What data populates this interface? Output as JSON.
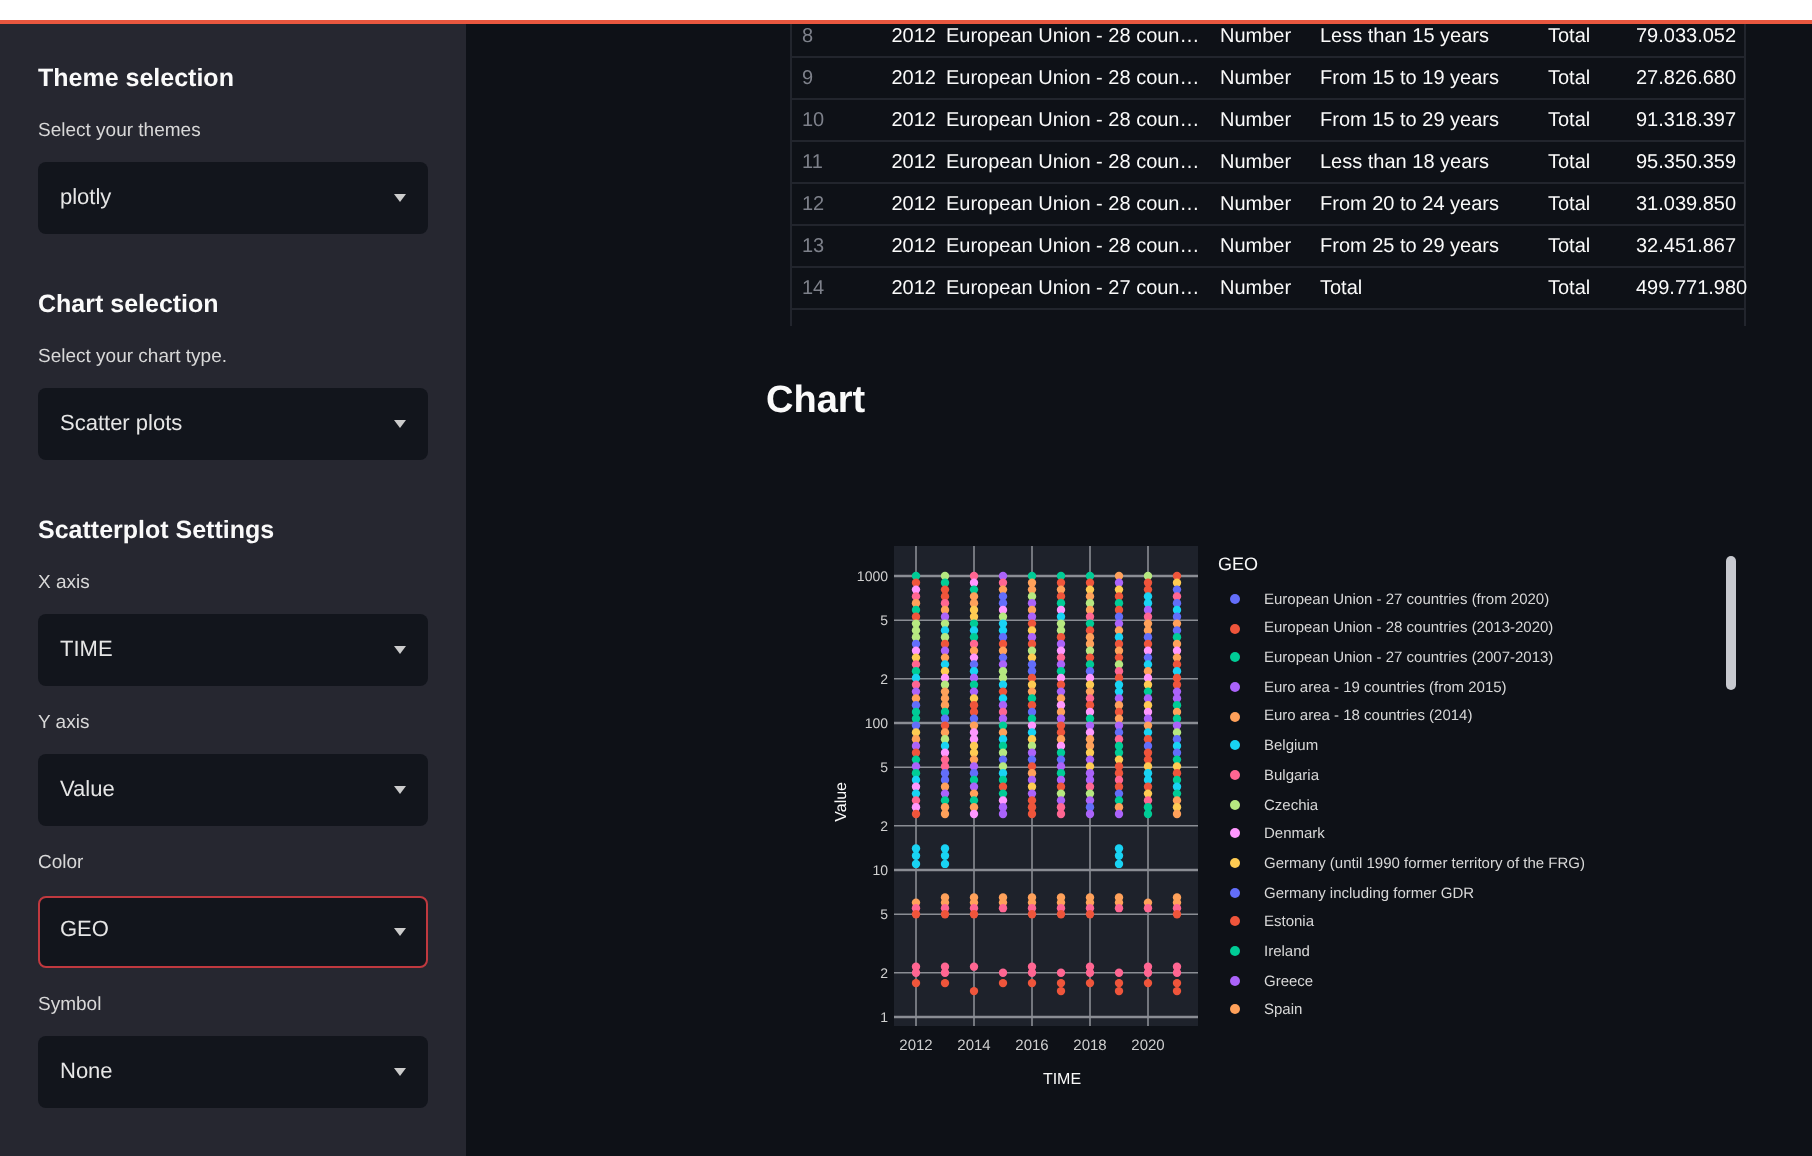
{
  "sidebar": {
    "sections": [
      {
        "heading": "Theme selection",
        "fields": [
          {
            "label": "Select your themes",
            "value": "plotly",
            "focused": false
          }
        ]
      },
      {
        "heading": "Chart selection",
        "fields": [
          {
            "label": "Select your chart type.",
            "value": "Scatter plots",
            "focused": false
          }
        ]
      },
      {
        "heading": "Scatterplot Settings",
        "fields": [
          {
            "label": "X axis",
            "value": "TIME",
            "focused": false
          },
          {
            "label": "Y axis",
            "value": "Value",
            "focused": false
          },
          {
            "label": "Color",
            "value": "GEO",
            "focused": true
          },
          {
            "label": "Symbol",
            "value": "None",
            "focused": false
          }
        ]
      }
    ]
  },
  "table": {
    "rows": [
      {
        "column_1": "8",
        "column_2": "2012",
        "column_3": "European Union - 28 coun…",
        "column_4": "Number",
        "column_5": "Less than 15 years",
        "column_6": "Total",
        "column_7": "79.033.052"
      },
      {
        "column_1": "9",
        "column_2": "2012",
        "column_3": "European Union - 28 coun…",
        "column_4": "Number",
        "column_5": "From 15 to 19 years",
        "column_6": "Total",
        "column_7": "27.826.680"
      },
      {
        "column_1": "10",
        "column_2": "2012",
        "column_3": "European Union - 28 coun…",
        "column_4": "Number",
        "column_5": "From 15 to 29 years",
        "column_6": "Total",
        "column_7": "91.318.397"
      },
      {
        "column_1": "11",
        "column_2": "2012",
        "column_3": "European Union - 28 coun…",
        "column_4": "Number",
        "column_5": "Less than 18 years",
        "column_6": "Total",
        "column_7": "95.350.359"
      },
      {
        "column_1": "12",
        "column_2": "2012",
        "column_3": "European Union - 28 coun…",
        "column_4": "Number",
        "column_5": "From 20 to 24 years",
        "column_6": "Total",
        "column_7": "31.039.850"
      },
      {
        "column_1": "13",
        "column_2": "2012",
        "column_3": "European Union - 28 coun…",
        "column_4": "Number",
        "column_5": "From 25 to 29 years",
        "column_6": "Total",
        "column_7": "32.451.867"
      },
      {
        "column_1": "14",
        "column_2": "2012",
        "column_3": "European Union - 27 coun…",
        "column_4": "Number",
        "column_5": "Total",
        "column_6": "Total",
        "column_7": "499.771.980"
      }
    ]
  },
  "chart_section": {
    "heading": "Chart",
    "chart": {
      "xlabel": "TIME",
      "ylabel": "Value",
      "xticks": [
        "2012",
        "2014",
        "2016",
        "2018",
        "2020"
      ],
      "yticks": [
        "1000",
        "5",
        "2",
        "100",
        "5",
        "2",
        "10",
        "5",
        "2",
        "1"
      ],
      "legend": {
        "title": "GEO",
        "items": [
          {
            "label": "European Union - 27 countries (from 2020)",
            "color": "#636efa"
          },
          {
            "label": "European Union - 28 countries (2013-2020)",
            "color": "#ef553b"
          },
          {
            "label": "European Union - 27 countries (2007-2013)",
            "color": "#00cc96"
          },
          {
            "label": "Euro area - 19 countries  (from 2015)",
            "color": "#ab63fa"
          },
          {
            "label": "Euro area - 18 countries (2014)",
            "color": "#ffa15a"
          },
          {
            "label": "Belgium",
            "color": "#19d3f3"
          },
          {
            "label": "Bulgaria",
            "color": "#ff6692"
          },
          {
            "label": "Czechia",
            "color": "#b6e880"
          },
          {
            "label": "Denmark",
            "color": "#ff97ff"
          },
          {
            "label": "Germany (until 1990 former territory of the FRG)",
            "color": "#fecb52"
          },
          {
            "label": "Germany including former GDR",
            "color": "#636efa"
          },
          {
            "label": "Estonia",
            "color": "#ef553b"
          },
          {
            "label": "Ireland",
            "color": "#00cc96"
          },
          {
            "label": "Greece",
            "color": "#ab63fa"
          },
          {
            "label": "Spain",
            "color": "#ffa15a"
          }
        ]
      }
    }
  }
}
